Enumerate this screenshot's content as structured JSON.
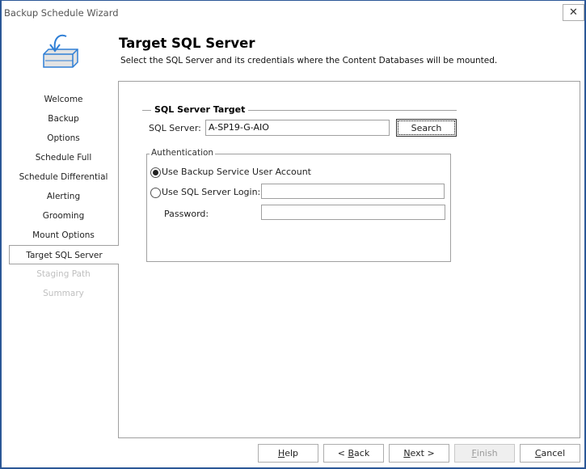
{
  "window": {
    "title": "Backup Schedule Wizard",
    "close_icon": "close-x-icon"
  },
  "header": {
    "icon": "backup-box-arrow-icon",
    "title": "Target SQL Server",
    "subtitle": "Select the SQL Server and its credentials where the Content Databases will be mounted."
  },
  "nav": {
    "items": [
      {
        "label": "Welcome",
        "state": "normal"
      },
      {
        "label": "Backup",
        "state": "normal"
      },
      {
        "label": "Options",
        "state": "normal"
      },
      {
        "label": "Schedule Full",
        "state": "normal"
      },
      {
        "label": "Schedule Differential",
        "state": "normal"
      },
      {
        "label": "Alerting",
        "state": "normal"
      },
      {
        "label": "Grooming",
        "state": "normal"
      },
      {
        "label": "Mount Options",
        "state": "normal"
      },
      {
        "label": "Target SQL Server",
        "state": "active"
      },
      {
        "label": "Staging Path",
        "state": "disabled"
      },
      {
        "label": "Summary",
        "state": "disabled"
      }
    ]
  },
  "target": {
    "group_label": "SQL Server Target",
    "server_label": "SQL Server:",
    "server_value": "A-SP19-G-AIO",
    "search_label": "Search"
  },
  "auth": {
    "group_label": "Authentication",
    "option_service": "Use Backup Service User Account",
    "option_sql": "Use SQL Server Login:",
    "selected": "service",
    "login_value": "",
    "password_label": "Password:",
    "password_value": ""
  },
  "footer": {
    "help": {
      "pre": "",
      "key": "H",
      "post": "elp"
    },
    "back": {
      "pre": "< ",
      "key": "B",
      "post": "ack"
    },
    "next": {
      "pre": "",
      "key": "N",
      "post": "ext >"
    },
    "finish": {
      "pre": "",
      "key": "F",
      "post": "inish",
      "disabled": true
    },
    "cancel": {
      "pre": "",
      "key": "C",
      "post": "ancel"
    }
  },
  "colors": {
    "window_border": "#2b5797",
    "icon_blue": "#2f7fd6",
    "disabled_text": "#c0c0c0"
  }
}
